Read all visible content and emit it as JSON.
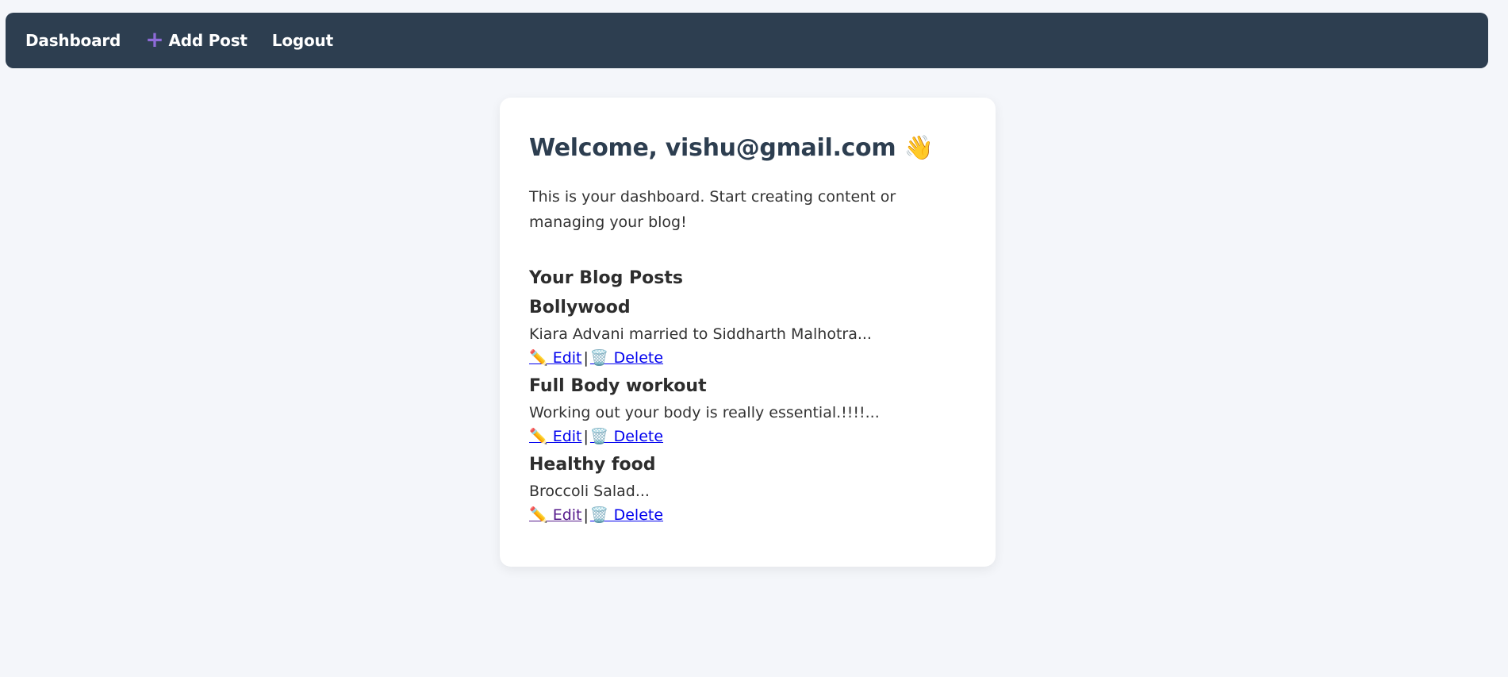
{
  "nav": {
    "dashboard": "Dashboard",
    "add_post_icon": "plus-icon",
    "add_post": "Add Post",
    "logout": "Logout"
  },
  "welcome": {
    "title": "Welcome, vishu@gmail.com 👋",
    "intro": "This is your dashboard. Start creating content or managing your blog!"
  },
  "posts_heading": "Your Blog Posts",
  "posts": [
    {
      "title": "Bollywood",
      "excerpt": "Kiara Advani married to Siddharth Malhotra...",
      "edit": "✏️ Edit",
      "delete": "🗑️ Delete"
    },
    {
      "title": "Full Body workout",
      "excerpt": "Working out your body is really essential.!!!!...",
      "edit": "✏️ Edit",
      "delete": "🗑️ Delete"
    },
    {
      "title": "Healthy food",
      "excerpt": "Broccoli Salad...",
      "edit": "✏️ Edit",
      "delete": "🗑️ Delete"
    }
  ],
  "separator": "|",
  "colors": {
    "navbar": "#2d3e50",
    "background": "#f4f6fa",
    "accent": "#8e6bd8",
    "link": "#0000ee",
    "visited_link": "#551a8b"
  }
}
